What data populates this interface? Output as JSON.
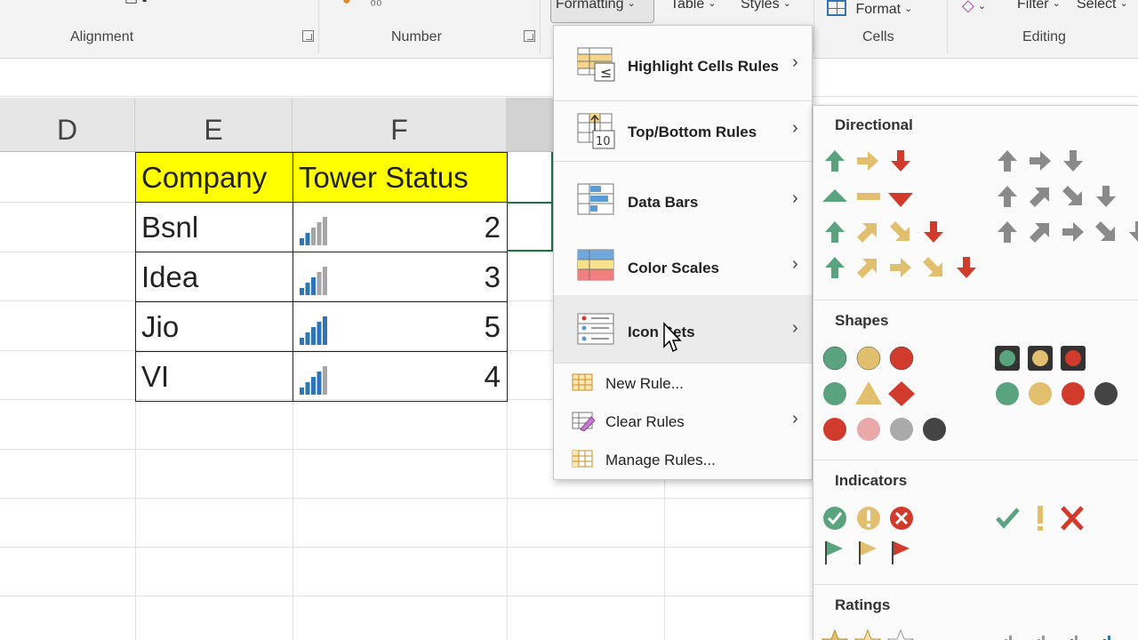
{
  "ribbon": {
    "groups": {
      "alignment": "Alignment",
      "number": "Number",
      "cells": "Cells",
      "editing": "Editing"
    },
    "buttons": {
      "conditional_formatting": "Formatting",
      "table": "Table",
      "styles": "Styles",
      "format": "Format",
      "filter": "Filter",
      "select": "Select"
    }
  },
  "sheet": {
    "columns": [
      "D",
      "E",
      "F"
    ],
    "header": [
      "Company",
      "Tower Status"
    ],
    "rows": [
      {
        "company": "Bsnl",
        "value": "2",
        "level": 2
      },
      {
        "company": "Idea",
        "value": "3",
        "level": 3
      },
      {
        "company": "Jio",
        "value": "5",
        "level": 5
      },
      {
        "company": "VI",
        "value": "4",
        "level": 4
      }
    ]
  },
  "menu": {
    "items": [
      {
        "label": "Highlight Cells Rules",
        "icon": "highlight-cells-icon"
      },
      {
        "label": "Top/Bottom Rules",
        "icon": "top-bottom-icon"
      },
      {
        "label": "Data Bars",
        "icon": "data-bars-icon"
      },
      {
        "label": "Color Scales",
        "icon": "color-scales-icon"
      },
      {
        "label": "Icon Sets",
        "icon": "icon-sets-icon"
      }
    ],
    "small": [
      {
        "label": "New Rule...",
        "icon": "new-rule-icon"
      },
      {
        "label": "Clear Rules",
        "icon": "clear-rules-icon"
      },
      {
        "label": "Manage Rules...",
        "icon": "manage-rules-icon"
      }
    ]
  },
  "submenu": {
    "sections": {
      "directional": "Directional",
      "shapes": "Shapes",
      "indicators": "Indicators",
      "ratings": "Ratings"
    }
  },
  "colors": {
    "green": "#5aa37f",
    "amber": "#e2bf6f",
    "red": "#d13b2b",
    "gray": "#8a8a8a",
    "highlight": "#ffff00",
    "select": "#217346"
  }
}
